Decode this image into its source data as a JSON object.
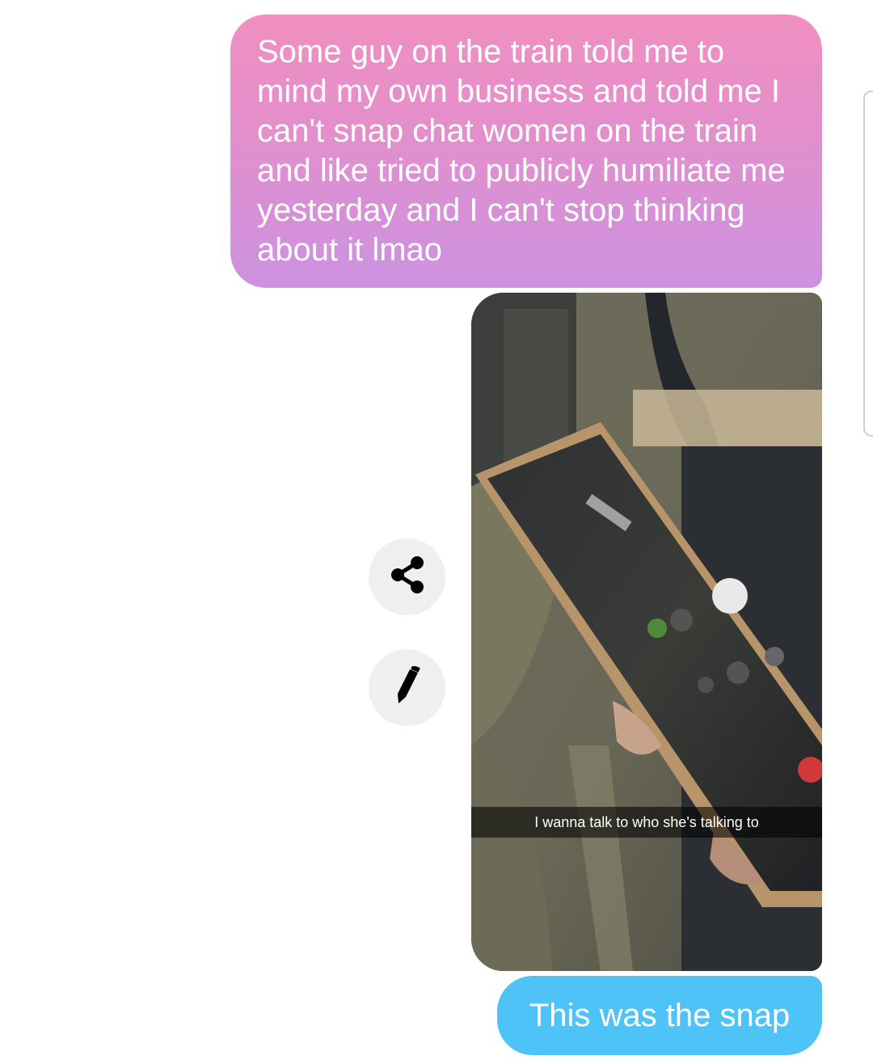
{
  "messages": {
    "sent_text": "Some guy on the train told me to mind my own business and told me I can't snap chat women on the train and like tried to publicly humiliate me yesterday and I can't stop thinking about it lmao",
    "snap_caption": "I wanna talk to who she's talking to",
    "reply_text": "This was the snap"
  },
  "actions": {
    "share_icon": "share-icon",
    "edit_icon": "pencil-icon"
  },
  "colors": {
    "gradient_top": "#f08fc0",
    "gradient_bottom": "#cb92e0",
    "blue_bubble": "#4dc3f8",
    "action_button_bg": "#efefef"
  }
}
